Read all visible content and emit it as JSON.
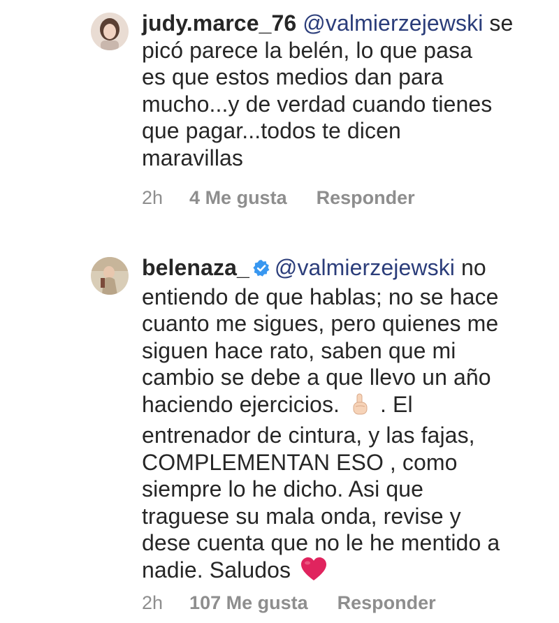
{
  "comments": [
    {
      "username": "judy.marce_76",
      "mention": "@valmierzejewski",
      "lines": [
        " se",
        "picó  parece la belén, lo que pasa",
        "es que estos medios dan para",
        "mucho...y de verdad cuando tienes",
        "que pagar...todos te dicen",
        "maravillas"
      ],
      "time": "2h",
      "likes": "4 Me gusta",
      "reply": "Responder",
      "verified": false
    },
    {
      "username": "belenaza_",
      "mention": "@valmierzejewski",
      "first_tail": " no",
      "line2": "entiendo de que hablas; no se hace",
      "line3": "cuanto me sigues, pero quienes me",
      "line4": "siguen hace rato, saben que mi",
      "line5": "cambio se debe a que llevo un año",
      "line6_a": "haciendo ejercicios. ",
      "line6_b": " . El",
      "line7": "entrenador de cintura, y las fajas,",
      "line8": "COMPLEMENTAN ESO , como",
      "line9": "siempre lo he dicho. Asi que",
      "line10": "traguese su mala onda, revise y",
      "line11": "dese cuenta que no le he mentido a",
      "line12": "nadie. Saludos ",
      "time": "2h",
      "likes": "107 Me gusta",
      "reply": "Responder",
      "verified": true,
      "emojis": [
        "index-pointing-up-emoji",
        "red-heart-emoji"
      ]
    }
  ],
  "colors": {
    "text": "#262626",
    "mention": "#2b3d7a",
    "meta": "#8e8e8e",
    "verified": "#3897f0",
    "heart": "#e0245e"
  }
}
